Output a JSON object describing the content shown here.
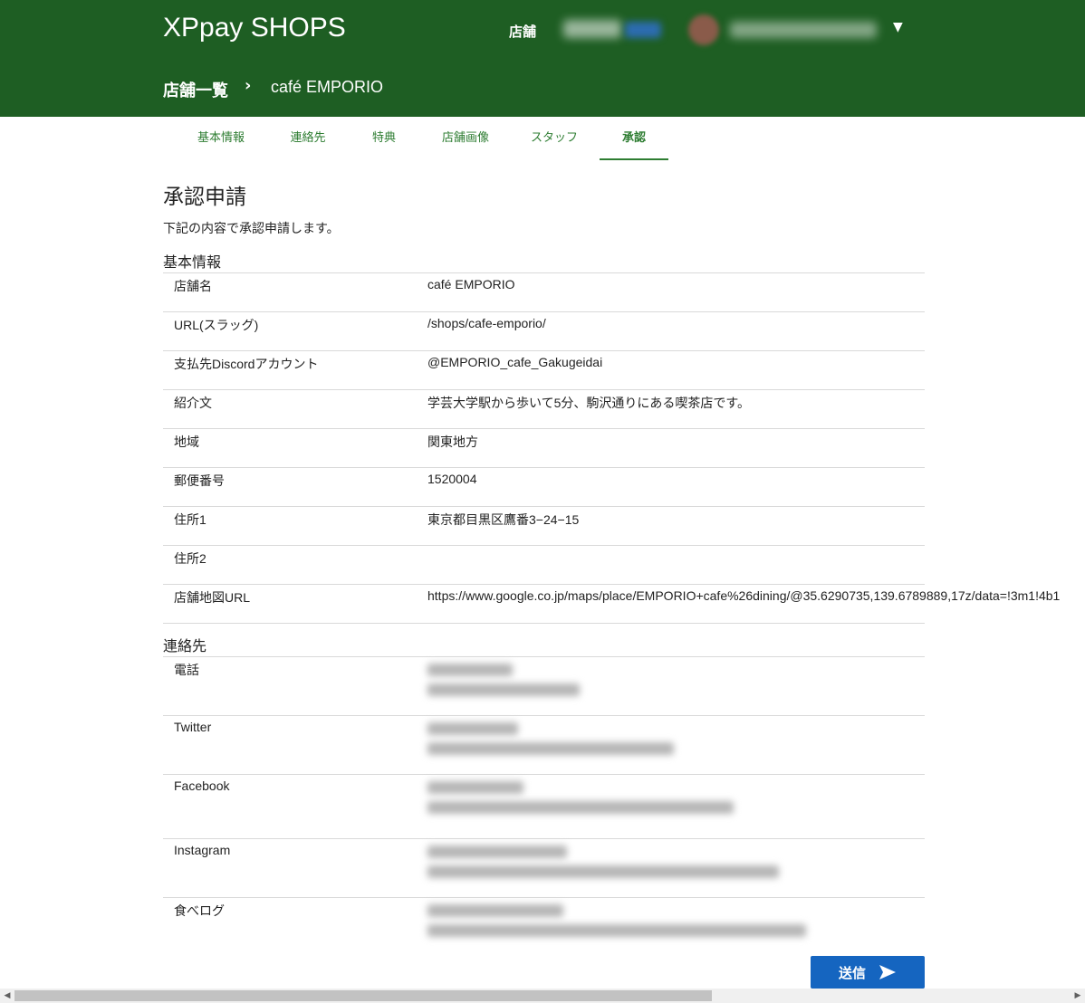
{
  "header": {
    "brand": "XPpay SHOPS",
    "nav_shops": "店舗",
    "breadcrumb": {
      "list": "店舗一覧",
      "separator": "›",
      "current": "café EMPORIO"
    }
  },
  "tabs": [
    "基本情報",
    "連絡先",
    "特典",
    "店舗画像",
    "スタッフ",
    "承認"
  ],
  "active_tab": "承認",
  "page": {
    "title": "承認申請",
    "description": "下記の内容で承認申請します。"
  },
  "basic_info": {
    "heading": "基本情報",
    "rows": [
      {
        "label": "店舗名",
        "value": "café EMPORIO"
      },
      {
        "label": "URL(スラッグ)",
        "value": "/shops/cafe-emporio/"
      },
      {
        "label": "支払先Discordアカウント",
        "value": "@EMPORIO_cafe_Gakugeidai"
      },
      {
        "label": "紹介文",
        "value": "学芸大学駅から歩いて5分、駒沢通りにある喫茶店です。"
      },
      {
        "label": "地域",
        "value": "関東地方"
      },
      {
        "label": "郵便番号",
        "value": "1520004"
      },
      {
        "label": "住所1",
        "value": "東京都目黒区鷹番3−24−15"
      },
      {
        "label": "住所2",
        "value": ""
      },
      {
        "label": "店舗地図URL",
        "value": "https://www.google.co.jp/maps/place/EMPORIO+cafe%26dining/@35.6290735,139.6789889,17z/data=!3m1!4b1"
      }
    ]
  },
  "contacts": {
    "heading": "連絡先",
    "rows": [
      {
        "label": "電話"
      },
      {
        "label": "Twitter"
      },
      {
        "label": "Facebook"
      },
      {
        "label": "Instagram"
      },
      {
        "label": "食べログ"
      }
    ]
  },
  "submit_label": "送信"
}
